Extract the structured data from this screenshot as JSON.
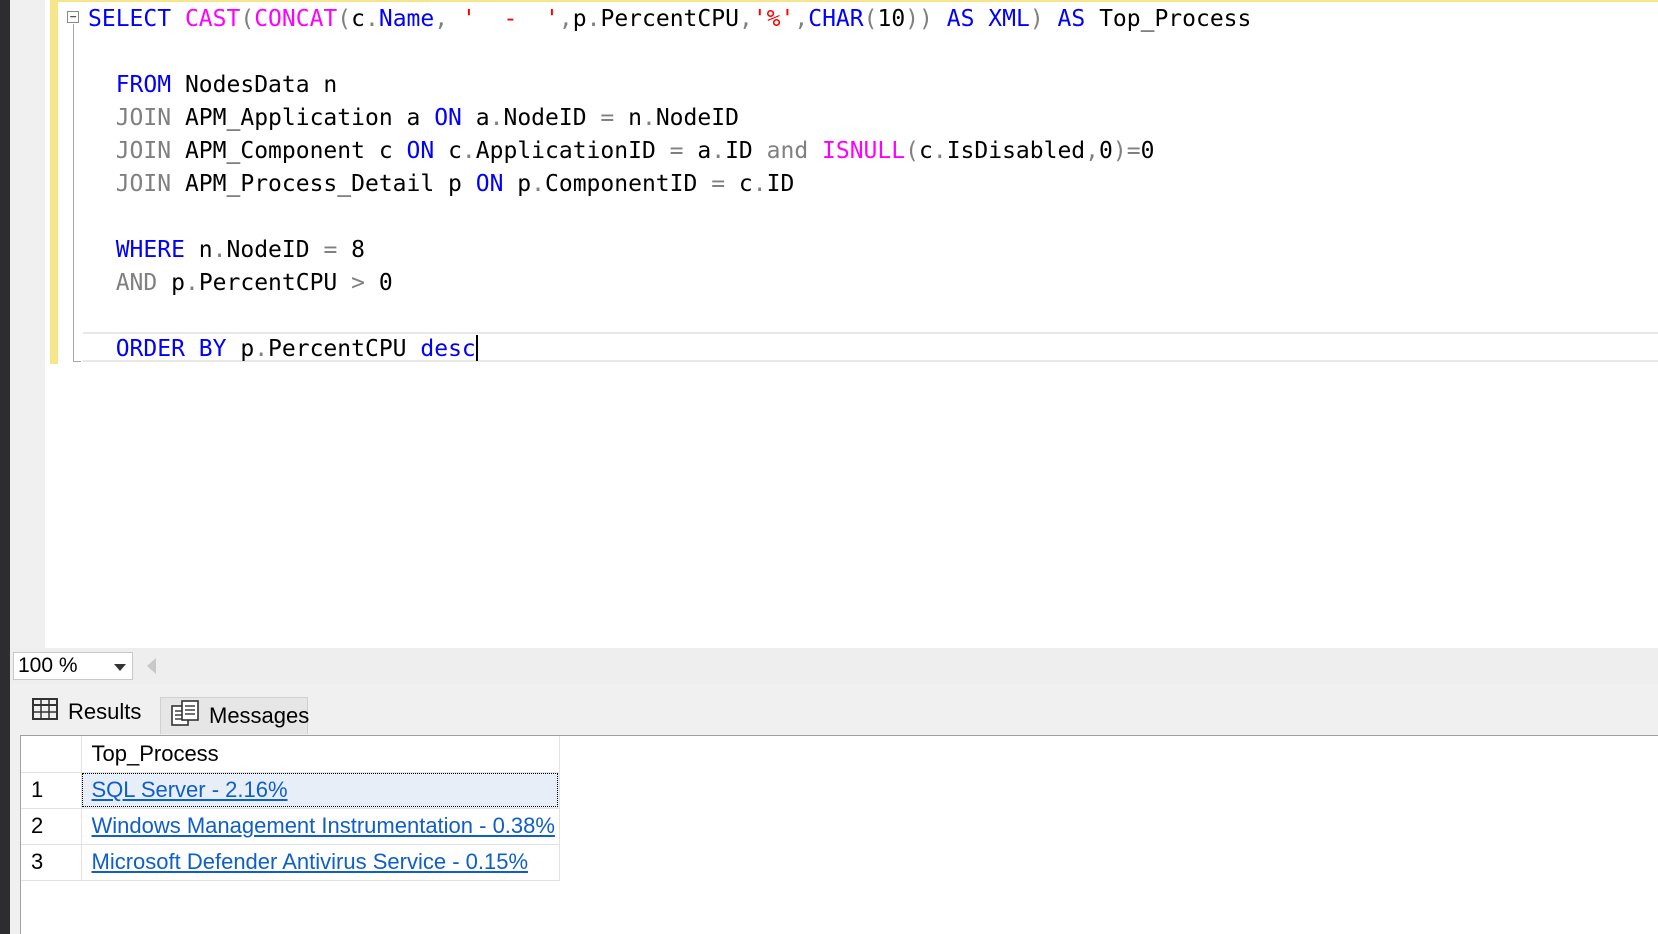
{
  "editor": {
    "lines": [
      [
        [
          "kw",
          "SELECT "
        ],
        [
          "fn",
          "CAST"
        ],
        [
          "op",
          "("
        ],
        [
          "fn",
          "CONCAT"
        ],
        [
          "op",
          "("
        ],
        [
          "tx",
          "c"
        ],
        [
          "op",
          "."
        ],
        [
          "kw",
          "Name"
        ],
        [
          "op",
          ", "
        ],
        [
          "str",
          "'  -  '"
        ],
        [
          "op",
          ","
        ],
        [
          "tx",
          "p"
        ],
        [
          "op",
          "."
        ],
        [
          "tx",
          "PercentCPU"
        ],
        [
          "op",
          ","
        ],
        [
          "str",
          "'%'"
        ],
        [
          "op",
          ","
        ],
        [
          "kw",
          "CHAR"
        ],
        [
          "op",
          "("
        ],
        [
          "tx",
          "10"
        ],
        [
          "op",
          "))"
        ],
        [
          "kw",
          " AS "
        ],
        [
          "kw",
          "XML"
        ],
        [
          "op",
          ")"
        ],
        [
          "kw",
          " AS "
        ],
        [
          "tx",
          "Top_Process"
        ]
      ],
      [],
      [
        [
          "tx",
          "  "
        ],
        [
          "kw",
          "FROM "
        ],
        [
          "tx",
          "NodesData n"
        ]
      ],
      [
        [
          "tx",
          "  "
        ],
        [
          "op",
          "JOIN "
        ],
        [
          "tx",
          "APM_Application a "
        ],
        [
          "kw",
          "ON "
        ],
        [
          "tx",
          "a"
        ],
        [
          "op",
          "."
        ],
        [
          "tx",
          "NodeID "
        ],
        [
          "op",
          "= "
        ],
        [
          "tx",
          "n"
        ],
        [
          "op",
          "."
        ],
        [
          "tx",
          "NodeID"
        ]
      ],
      [
        [
          "tx",
          "  "
        ],
        [
          "op",
          "JOIN "
        ],
        [
          "tx",
          "APM_Component c "
        ],
        [
          "kw",
          "ON "
        ],
        [
          "tx",
          "c"
        ],
        [
          "op",
          "."
        ],
        [
          "tx",
          "ApplicationID "
        ],
        [
          "op",
          "= "
        ],
        [
          "tx",
          "a"
        ],
        [
          "op",
          "."
        ],
        [
          "tx",
          "ID "
        ],
        [
          "op",
          "and "
        ],
        [
          "fn",
          "ISNULL"
        ],
        [
          "op",
          "("
        ],
        [
          "tx",
          "c"
        ],
        [
          "op",
          "."
        ],
        [
          "tx",
          "IsDisabled"
        ],
        [
          "op",
          ","
        ],
        [
          "tx",
          "0"
        ],
        [
          "op",
          ")="
        ],
        [
          "tx",
          "0"
        ]
      ],
      [
        [
          "tx",
          "  "
        ],
        [
          "op",
          "JOIN "
        ],
        [
          "tx",
          "APM_Process_Detail p "
        ],
        [
          "kw",
          "ON "
        ],
        [
          "tx",
          "p"
        ],
        [
          "op",
          "."
        ],
        [
          "tx",
          "ComponentID "
        ],
        [
          "op",
          "= "
        ],
        [
          "tx",
          "c"
        ],
        [
          "op",
          "."
        ],
        [
          "tx",
          "ID"
        ]
      ],
      [],
      [
        [
          "tx",
          "  "
        ],
        [
          "kw",
          "WHERE "
        ],
        [
          "tx",
          "n"
        ],
        [
          "op",
          "."
        ],
        [
          "tx",
          "NodeID "
        ],
        [
          "op",
          "= "
        ],
        [
          "tx",
          "8"
        ]
      ],
      [
        [
          "tx",
          "  "
        ],
        [
          "op",
          "AND "
        ],
        [
          "tx",
          "p"
        ],
        [
          "op",
          "."
        ],
        [
          "tx",
          "PercentCPU "
        ],
        [
          "op",
          "> "
        ],
        [
          "tx",
          "0"
        ]
      ],
      [],
      [
        [
          "tx",
          "  "
        ],
        [
          "kw",
          "ORDER BY "
        ],
        [
          "tx",
          "p"
        ],
        [
          "op",
          "."
        ],
        [
          "tx",
          "PercentCPU "
        ],
        [
          "kw",
          "desc"
        ]
      ]
    ]
  },
  "zoom": {
    "value": "100 %"
  },
  "tabs": {
    "results": "Results",
    "messages": "Messages"
  },
  "grid": {
    "column": "Top_Process",
    "rows": [
      {
        "num": "1",
        "value": "SQL Server  -  2.16%"
      },
      {
        "num": "2",
        "value": "Windows Management Instrumentation  -  0.38%"
      },
      {
        "num": "3",
        "value": "Microsoft Defender Antivirus Service  -  0.15%"
      }
    ]
  },
  "colors": {
    "keyword": "#0000ff",
    "function": "#ff00ff",
    "operator": "#808080",
    "string": "#ff0000",
    "link": "#0e5fc9"
  }
}
